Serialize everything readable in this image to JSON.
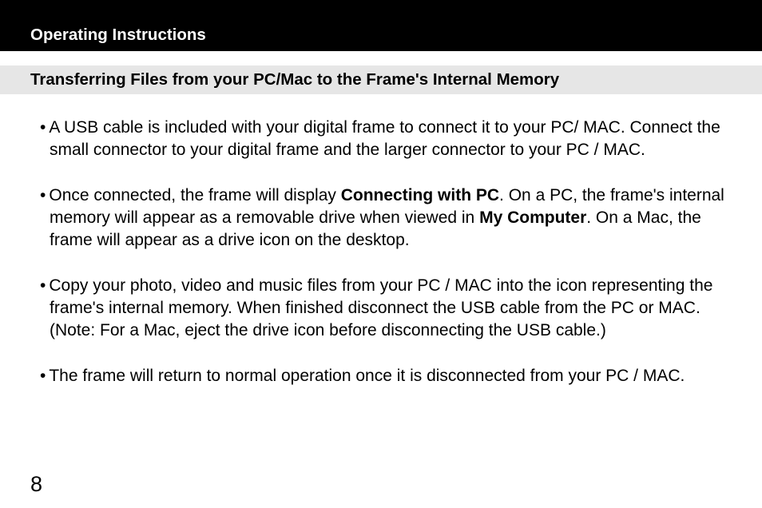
{
  "header": "Operating Instructions",
  "subheader": "Transferring Files from your PC/Mac to the Frame's Internal Memory",
  "bullets": {
    "b1": "A USB cable is included with your digital frame to connect it to your PC/ MAC.  Connect the small connector to your digital frame and the larger connector to your PC / MAC.",
    "b2a": "Once connected, the frame will display ",
    "b2b_bold": "Connecting with PC",
    "b2c": ".  On a PC, the frame's internal memory will appear as a removable drive when viewed in ",
    "b2d_bold": "My Computer",
    "b2e": ". On a Mac, the frame will appear as a drive icon on the desktop.",
    "b3": "Copy your photo, video and music files from your PC / MAC into the icon representing the frame's internal memory.  When finished disconnect the USB cable from the PC or MAC.  (Note: For a Mac, eject the drive icon before disconnecting the USB cable.)",
    "b4": "The frame will return to normal operation once it is disconnected from your PC / MAC."
  },
  "pageNumber": "8",
  "dot": "•"
}
